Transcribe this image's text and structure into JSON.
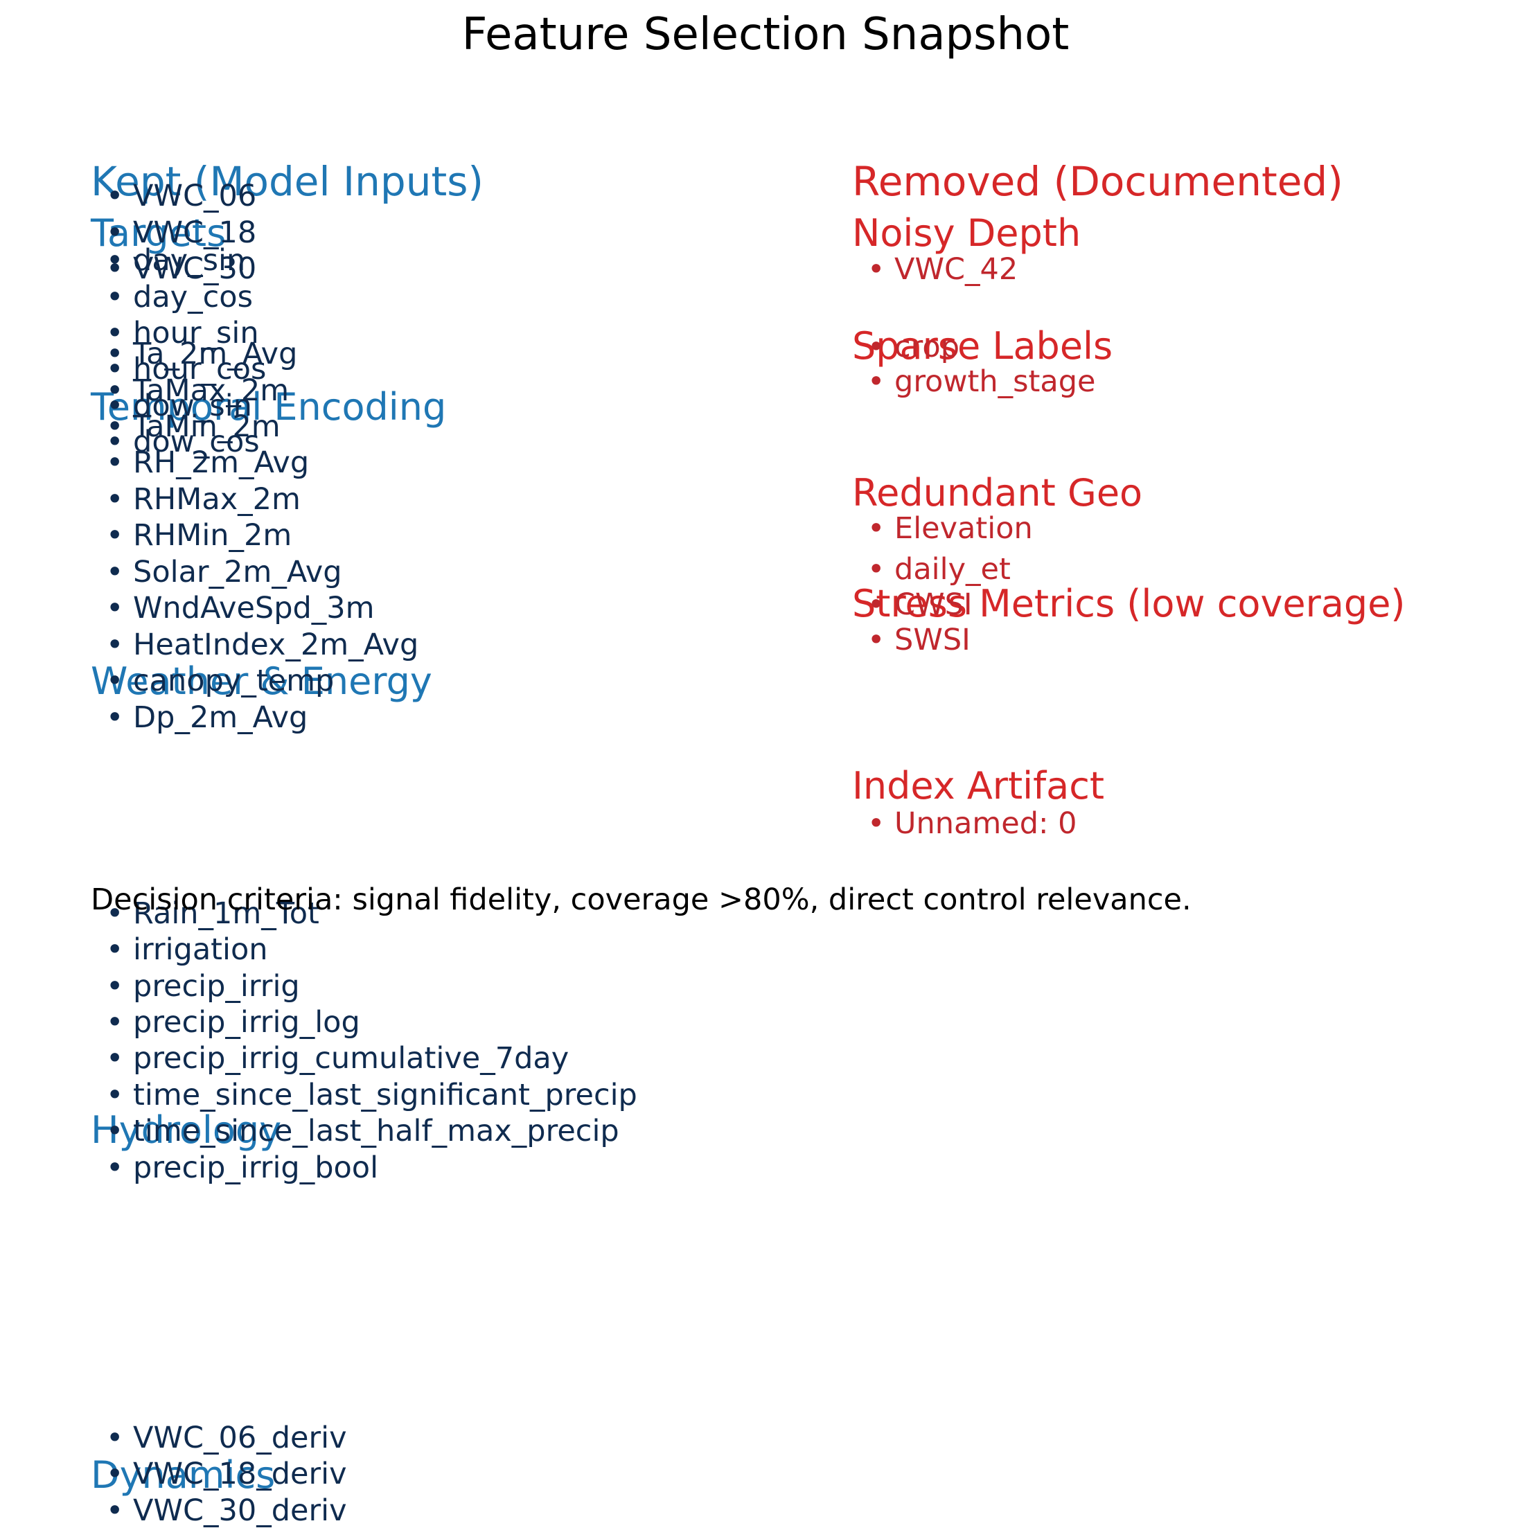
{
  "title": "Feature Selection Snapshot",
  "kept": {
    "heading": "Kept (Model Inputs)",
    "groups": [
      {
        "label": "Targets",
        "items": [
          "• VWC_06",
          "• VWC_18",
          "• VWC_30"
        ]
      },
      {
        "label": "Temporal Encoding",
        "items": [
          "• day_sin",
          "• day_cos",
          "• hour_sin",
          "• hour_cos",
          "• dow_sin",
          "• dow_cos"
        ]
      },
      {
        "label": "Weather & Energy",
        "items": [
          "• Ta_2m_Avg",
          "• TaMax_2m",
          "• TaMin_2m",
          "• RH_2m_Avg",
          "• RHMax_2m",
          "• RHMin_2m",
          "• Solar_2m_Avg",
          "• WndAveSpd_3m",
          "• HeatIndex_2m_Avg",
          "• canopy_temp",
          "• Dp_2m_Avg"
        ]
      },
      {
        "label": "Hydrology",
        "items": [
          "• Rain_1m_Tot",
          "• irrigation",
          "• precip_irrig",
          "• precip_irrig_log",
          "• precip_irrig_cumulative_7day",
          "• time_since_last_significant_precip",
          "• time_since_last_half_max_precip",
          "• precip_irrig_bool"
        ]
      },
      {
        "label": "Dynamics",
        "items": [
          "• VWC_06_deriv",
          "• VWC_18_deriv",
          "• VWC_30_deriv"
        ]
      }
    ]
  },
  "removed": {
    "heading": "Removed (Documented)",
    "groups": [
      {
        "label": "Noisy Depth",
        "items": [
          "• VWC_42"
        ]
      },
      {
        "label": "Sparse Labels",
        "items": [
          "• crop",
          "• growth_stage"
        ]
      },
      {
        "label": "Redundant Geo",
        "items": [
          "• Elevation"
        ]
      },
      {
        "label": "Stress Metrics (low coverage)",
        "items": [
          "• daily_et",
          "• CWSI",
          "• SWSI"
        ]
      },
      {
        "label": "Index Artifact",
        "items": [
          "• Unnamed: 0"
        ]
      }
    ]
  },
  "criteria": "Decision criteria: signal fidelity, coverage >80%, direct control relevance.",
  "colors": {
    "kept_heading": "#1f77b4",
    "kept_items": "#0f2b4f",
    "removed_heading": "#d62728",
    "removed_items": "#c0272d"
  }
}
